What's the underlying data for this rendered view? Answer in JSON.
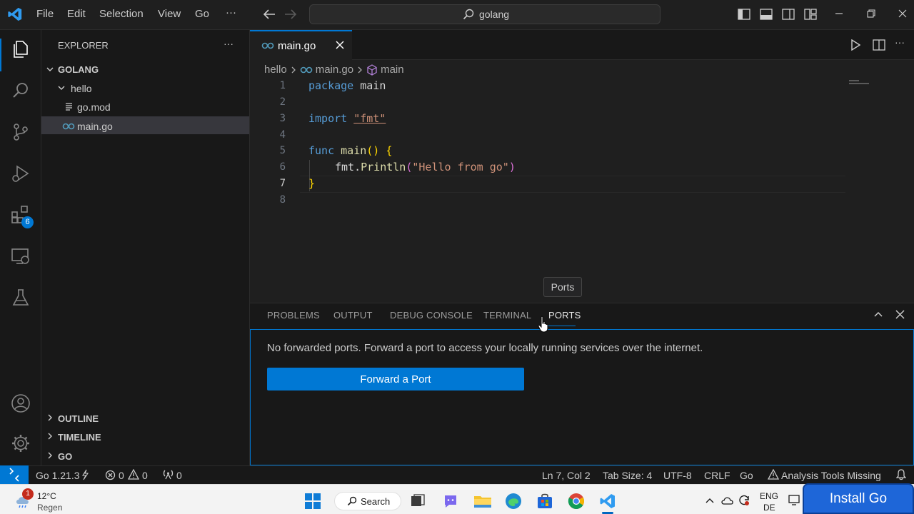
{
  "menu": {
    "file": "File",
    "edit": "Edit",
    "selection": "Selection",
    "view": "View",
    "go": "Go",
    "more": "···"
  },
  "search": {
    "label": "golang"
  },
  "explorer": {
    "title": "EXPLORER",
    "more": "···",
    "root": "GOLANG",
    "folder": "hello",
    "files": [
      "go.mod",
      "main.go"
    ],
    "sections": [
      "OUTLINE",
      "TIMELINE",
      "GO"
    ]
  },
  "activity": {
    "extensions_badge": "6"
  },
  "tab": {
    "label": "main.go"
  },
  "breadcrumb": {
    "folder": "hello",
    "file": "main.go",
    "symbol": "main"
  },
  "code": {
    "line_numbers": [
      "1",
      "2",
      "3",
      "4",
      "5",
      "6",
      "7",
      "8"
    ],
    "l1_kw": "package",
    "l1_rest": " main",
    "l3_kw": "import",
    "l3_str": "\"fmt\"",
    "l5_kw": "func",
    "l5_fn": "main",
    "l5_paren": "()",
    "l5_brace": "{",
    "l6_pkg": "fmt.",
    "l6_fn": "Println",
    "l6_open": "(",
    "l6_str": "\"Hello from go\"",
    "l6_close": ")",
    "l7_brace": "}"
  },
  "panel": {
    "tabs": [
      "PROBLEMS",
      "OUTPUT",
      "DEBUG CONSOLE",
      "TERMINAL",
      "PORTS"
    ],
    "tooltip": "Ports",
    "message": "No forwarded ports. Forward a port to access your locally running services over the internet.",
    "forward_button": "Forward a Port"
  },
  "status": {
    "go_version": "Go 1.21.3",
    "errors": "0",
    "warnings": "0",
    "ports": "0",
    "position": "Ln 7, Col 2",
    "tab_size": "Tab Size: 4",
    "encoding": "UTF-8",
    "eol": "CRLF",
    "language": "Go",
    "analysis": "Analysis Tools Missing"
  },
  "taskbar": {
    "weather_temp": "12°C",
    "weather_desc": "Regen",
    "weather_badge": "1",
    "search": "Search",
    "lang_top": "ENG",
    "lang_bottom": "DE",
    "install_button": "Install Go"
  },
  "colors": {
    "accent": "#0078d4",
    "keyword": "#569cd6",
    "string": "#ce9178",
    "function": "#dcdcaa"
  }
}
